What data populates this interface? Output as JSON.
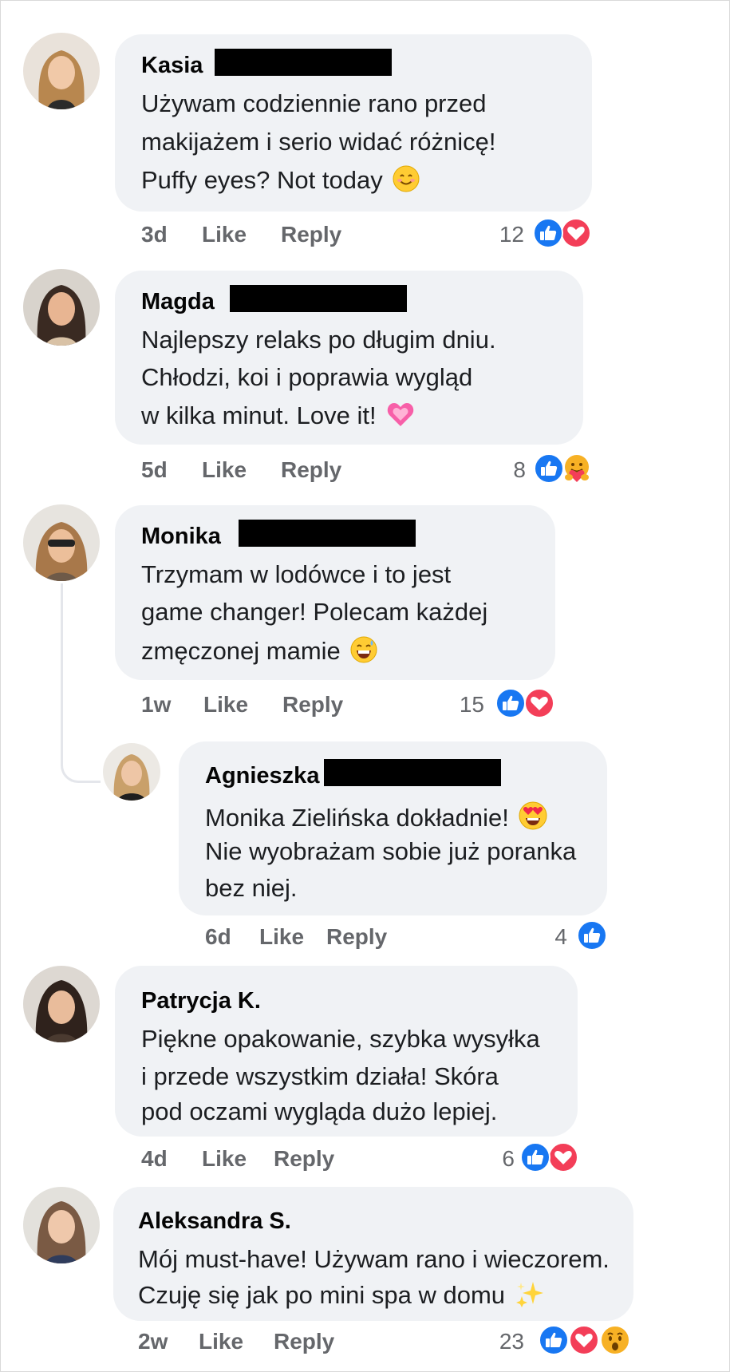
{
  "comments": [
    {
      "author": "Kasia",
      "lines": [
        "Używam codziennie rano przed",
        "makijażem i serio widać różnicę!",
        "Puffy eyes? Not today"
      ],
      "emoji": "smiling-face-emoji",
      "time": "3d",
      "like": "Like",
      "reply": "Reply",
      "count": "12",
      "reactions": [
        "like",
        "love"
      ]
    },
    {
      "author": "Magda",
      "lines": [
        "Najlepszy relaks po długim dniu.",
        "Chłodzi, koi i poprawia wygląd",
        "w kilka minut. Love it!"
      ],
      "emoji": "growing-heart-emoji",
      "time": "5d",
      "like": "Like",
      "reply": "Reply",
      "count": "8",
      "reactions": [
        "like",
        "care"
      ]
    },
    {
      "author": "Monika",
      "lines": [
        "Trzymam w lodówce i to jest",
        "game changer! Polecam każdej",
        "zmęczonej mamie"
      ],
      "emoji": "grinning-sweat-emoji",
      "time": "1w",
      "like": "Like",
      "reply": "Reply",
      "count": "15",
      "reactions": [
        "like",
        "love"
      ]
    },
    {
      "author": "Agnieszka",
      "lines": [
        "Monika Zielińska dokładnie!",
        "Nie wyobrażam sobie już poranka",
        "bez niej."
      ],
      "emoji": "heart-eyes-emoji",
      "time": "6d",
      "like": "Like",
      "reply": "Reply",
      "count": "4",
      "reactions": [
        "like"
      ]
    },
    {
      "author": "Patrycja K.",
      "lines": [
        "Piękne opakowanie, szybka wysyłka",
        "i przede wszystkim działa! Skóra",
        "pod oczami wygląda dużo lepiej."
      ],
      "emoji": "",
      "time": "4d",
      "like": "Like",
      "reply": "Reply",
      "count": "6",
      "reactions": [
        "like",
        "love"
      ]
    },
    {
      "author": "Aleksandra S.",
      "lines": [
        "Mój must-have! Używam rano i wieczorem.",
        "Czuję się jak po mini spa w domu"
      ],
      "emoji": "sparkles-emoji",
      "time": "2w",
      "like": "Like",
      "reply": "Reply",
      "count": "23",
      "reactions": [
        "like",
        "love",
        "wow"
      ]
    }
  ],
  "colors": {
    "bubble": "#f0f2f5",
    "like_blue": "#1877f2",
    "love_red": "#f33e58",
    "meta_gray": "#65676b"
  }
}
